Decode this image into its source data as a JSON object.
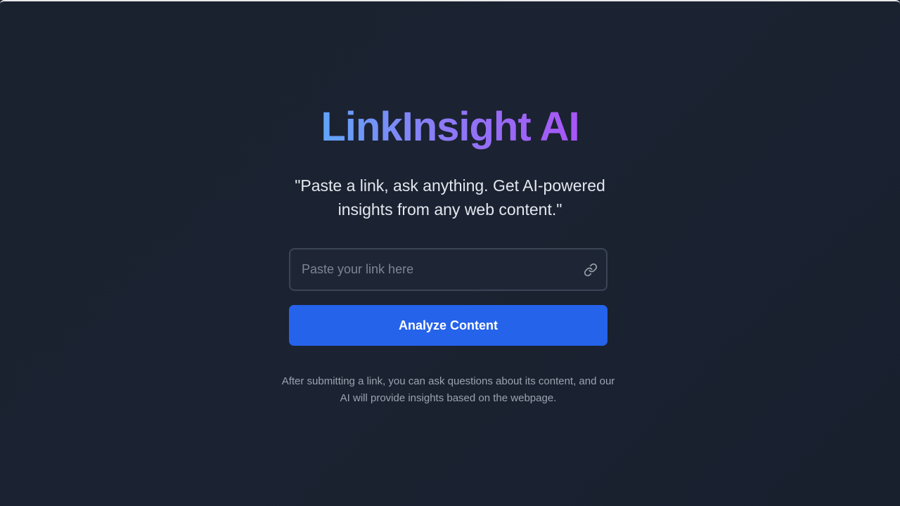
{
  "app": {
    "title": "LinkInsight AI",
    "tagline": "\"Paste a link, ask anything. Get AI-powered insights from any web content.\""
  },
  "form": {
    "link_input": {
      "value": "",
      "placeholder": "Paste your link here",
      "icon": "link-icon"
    },
    "submit_label": "Analyze Content"
  },
  "help": {
    "text": "After submitting a link, you can ask questions about its content, and our AI will provide insights based on the webpage."
  },
  "colors": {
    "background": "#1b2231",
    "title_gradient_start": "#60a5fa",
    "title_gradient_end": "#a855f7",
    "button": "#2563eb",
    "input_border": "#3b4555",
    "help_text": "#9ca3af"
  }
}
